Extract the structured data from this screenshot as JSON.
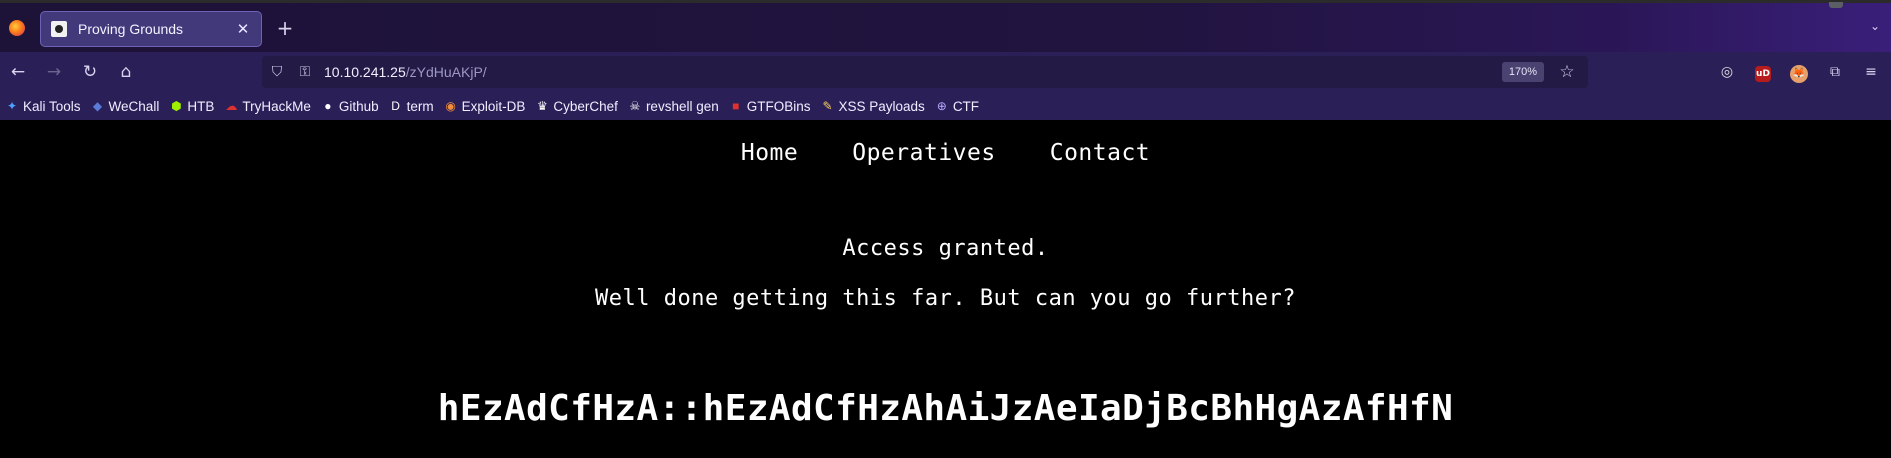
{
  "browser": {
    "tab": {
      "title": "Proving Grounds"
    },
    "newtab_symbol": "+",
    "url": {
      "host": "10.10.241.25",
      "path": "/zYdHuAKjP/"
    },
    "zoom": "170%",
    "bookmarks": [
      {
        "label": "Kali Tools",
        "icon": "kali-icon",
        "color": "#4ea1ff",
        "glyph": "✦"
      },
      {
        "label": "WeChall",
        "icon": "wechall-icon",
        "color": "#5a7bd8",
        "glyph": "◆"
      },
      {
        "label": "HTB",
        "icon": "htb-cube-icon",
        "color": "#9fef00",
        "glyph": "⬢"
      },
      {
        "label": "TryHackMe",
        "icon": "thm-cloud-icon",
        "color": "#e03131",
        "glyph": "☁"
      },
      {
        "label": "Github",
        "icon": "github-icon",
        "color": "#ffffff",
        "glyph": "●"
      },
      {
        "label": "term",
        "icon": "term-icon",
        "color": "#ffffff",
        "glyph": "D"
      },
      {
        "label": "Exploit-DB",
        "icon": "exploitdb-icon",
        "color": "#f08c3a",
        "glyph": "◉"
      },
      {
        "label": "CyberChef",
        "icon": "chef-hat-icon",
        "color": "#ffffff",
        "glyph": "♛"
      },
      {
        "label": "revshell gen",
        "icon": "skull-icon",
        "color": "#ffffff",
        "glyph": "☠"
      },
      {
        "label": "GTFOBins",
        "icon": "gtfobins-icon",
        "color": "#e03131",
        "glyph": "■"
      },
      {
        "label": "XSS Payloads",
        "icon": "xss-icon",
        "color": "#f5d061",
        "glyph": "✎"
      },
      {
        "label": "CTF",
        "icon": "globe-icon",
        "color": "#b9a8ff",
        "glyph": "⊕"
      }
    ]
  },
  "page": {
    "nav": [
      "Home",
      "Operatives",
      "Contact"
    ],
    "message_line1": "Access granted.",
    "message_line2": "Well done getting this far. But can you go further?",
    "code": "hEzAdCfHzA::hEzAdCfHzAhAiJzAeIaDjBcBhHgAzAfHfN"
  }
}
